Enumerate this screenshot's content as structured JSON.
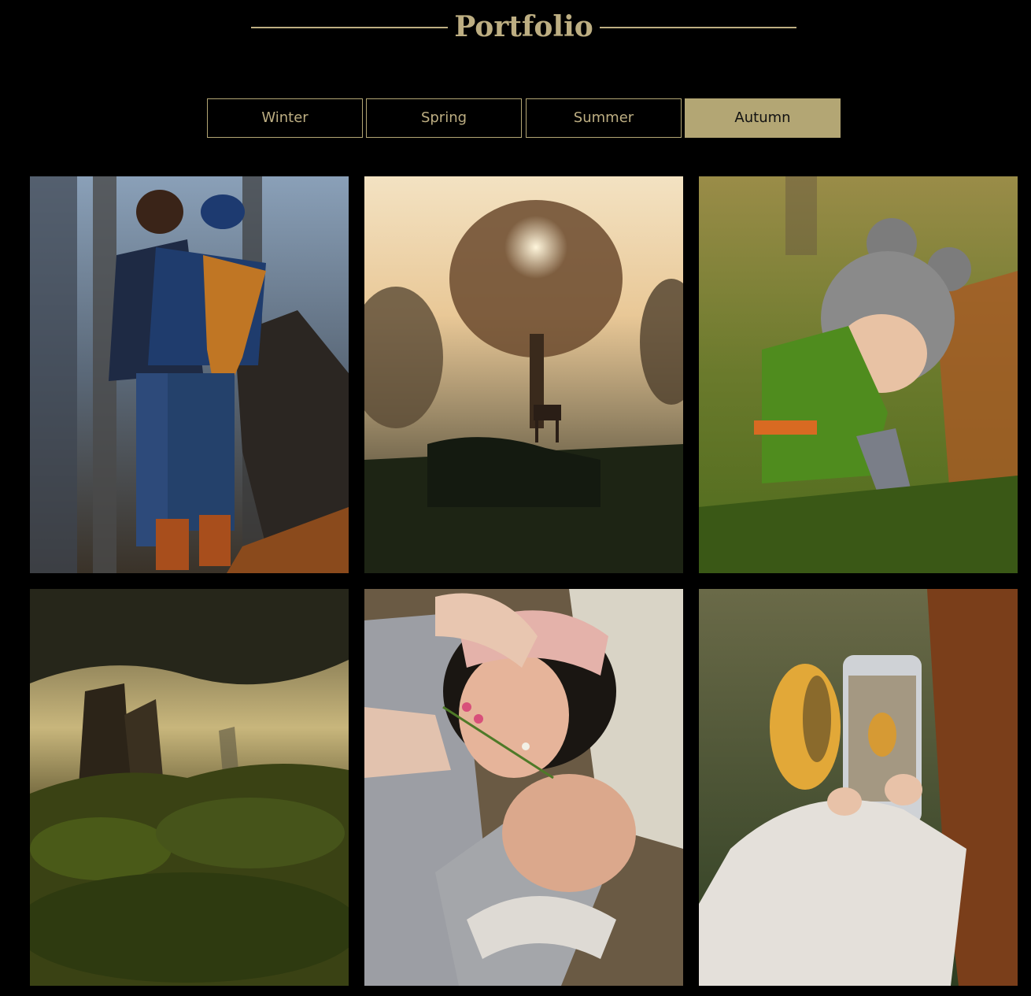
{
  "header": {
    "title": "Portfolio"
  },
  "tabs": [
    {
      "label": "Winter",
      "active": false
    },
    {
      "label": "Spring",
      "active": false
    },
    {
      "label": "Summer",
      "active": false
    },
    {
      "label": "Autumn",
      "active": true
    }
  ],
  "colors": {
    "background": "#000000",
    "accent": "#b3a674",
    "title": "#bdae82"
  },
  "gallery": {
    "category": "Autumn",
    "photos": [
      {
        "subject": "couple-kissing-forest-photo"
      },
      {
        "subject": "misty-tree-horse-sunrise-photo"
      },
      {
        "subject": "child-knit-hat-grass-photo"
      },
      {
        "subject": "mossy-forest-fog-photo"
      },
      {
        "subject": "smiling-couple-flowers-photo"
      },
      {
        "subject": "phone-autumn-leaf-photo"
      }
    ]
  }
}
